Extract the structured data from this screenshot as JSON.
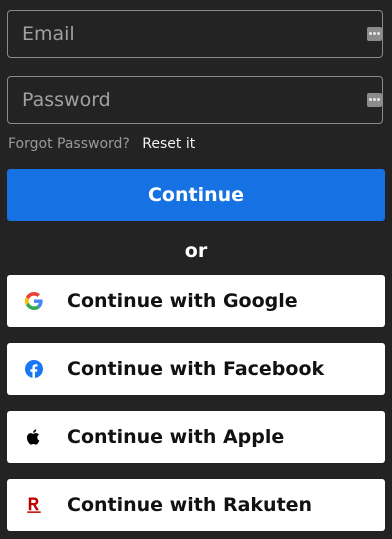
{
  "form": {
    "email_placeholder": "Email",
    "password_placeholder": "Password",
    "forgot_label": "Forgot Password?",
    "reset_link": "Reset it",
    "continue_label": "Continue",
    "or_label": "or"
  },
  "social": [
    {
      "label": "Continue with Google",
      "icon": "google-icon"
    },
    {
      "label": "Continue with Facebook",
      "icon": "facebook-icon"
    },
    {
      "label": "Continue with Apple",
      "icon": "apple-icon"
    },
    {
      "label": "Continue with Rakuten",
      "icon": "rakuten-icon"
    }
  ],
  "colors": {
    "background": "#232323",
    "primary": "#1672e2",
    "facebook": "#1877f2",
    "rakuten": "#bf0000"
  }
}
